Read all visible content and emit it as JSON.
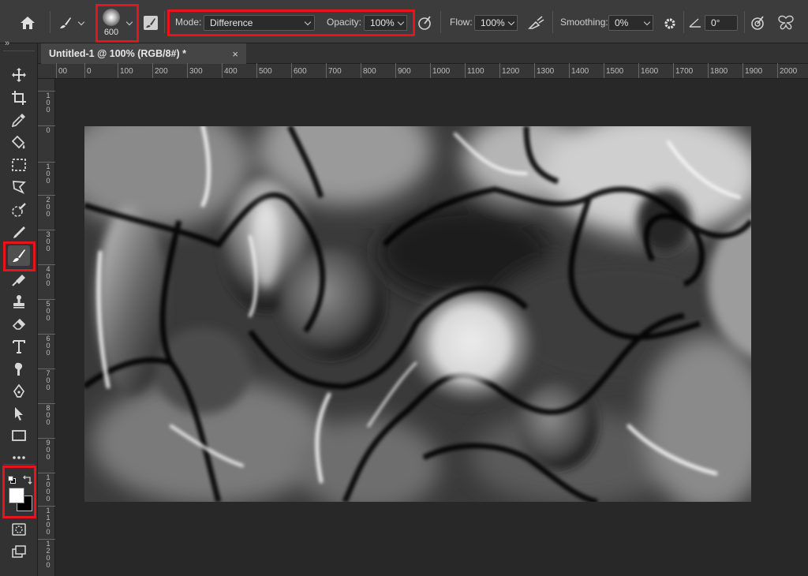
{
  "options_bar": {
    "brush_size": "600",
    "mode_label": "Mode:",
    "mode_value": "Difference",
    "opacity_label": "Opacity:",
    "opacity_value": "100%",
    "flow_label": "Flow:",
    "flow_value": "100%",
    "smoothing_label": "Smoothing:",
    "smoothing_value": "0%",
    "angle_value": "0°"
  },
  "document": {
    "tab_title": "Untitled-1 @ 100% (RGB/8#) *",
    "close_glyph": "×"
  },
  "rulers": {
    "horizontal": [
      "00",
      "0",
      "100",
      "200",
      "300",
      "400",
      "500",
      "600",
      "700",
      "800",
      "900",
      "1000",
      "1100",
      "1200",
      "1300",
      "1400",
      "1500",
      "1600",
      "1700",
      "1800",
      "1900",
      "2000"
    ],
    "vertical": [
      "100",
      "0",
      "100",
      "200",
      "300",
      "400",
      "500",
      "600",
      "700",
      "800",
      "900",
      "1000",
      "1100",
      "1200"
    ]
  },
  "toolbar": {
    "collapse_glyph": "»",
    "tools": [
      "move-icon",
      "crop-icon",
      "eyedropper-icon",
      "paint-bucket-icon",
      "marquee-icon",
      "lasso-icon",
      "quick-selection-icon",
      "pencil-icon",
      "brush-icon",
      "eraser-mix-icon",
      "clone-stamp-icon",
      "eraser-icon",
      "type-icon",
      "smudge-icon",
      "pen-icon",
      "path-selection-icon",
      "rectangle-icon",
      "more-icon"
    ],
    "foreground_color": "#ffffff",
    "background_color": "#000000"
  },
  "colors": {
    "highlight": "#e8141b",
    "panel": "#3c3c3c",
    "workspace": "#282828"
  }
}
